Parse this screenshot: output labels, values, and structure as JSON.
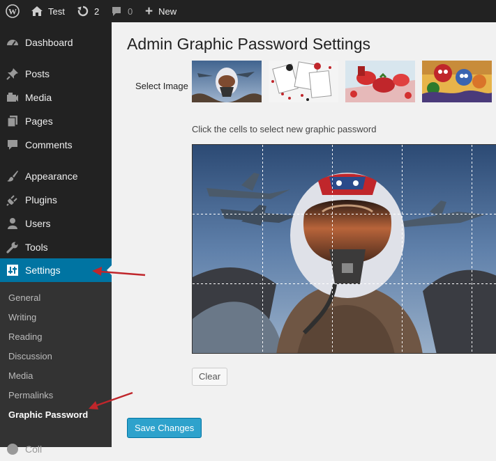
{
  "admin_bar": {
    "site_name": "Test",
    "updates_count": "2",
    "comments_count": "0",
    "new_label": "New"
  },
  "sidebar": {
    "items": [
      {
        "label": "Dashboard",
        "icon": "dashboard-icon"
      },
      {
        "label": "Posts",
        "icon": "pushpin-icon"
      },
      {
        "label": "Media",
        "icon": "camera-icon"
      },
      {
        "label": "Pages",
        "icon": "pages-icon"
      },
      {
        "label": "Comments",
        "icon": "comment-bubble-icon"
      },
      {
        "label": "Appearance",
        "icon": "paintbrush-icon"
      },
      {
        "label": "Plugins",
        "icon": "plug-icon"
      },
      {
        "label": "Users",
        "icon": "user-icon"
      },
      {
        "label": "Tools",
        "icon": "wrench-icon"
      },
      {
        "label": "Settings",
        "icon": "settings-sliders-icon"
      }
    ],
    "submenu": [
      "General",
      "Writing",
      "Reading",
      "Discussion",
      "Media",
      "Permalinks",
      "Graphic Password"
    ],
    "truncated_next_label": "Coll"
  },
  "page": {
    "title": "Admin Graphic Password Settings",
    "select_image_label": "Select Image",
    "thumbnails": [
      "pilot-helmet",
      "playing-cards",
      "strawberries",
      "cartoon-characters"
    ],
    "instructions": "Click the cells to select new graphic password",
    "clear_label": "Clear",
    "save_label": "Save Changes"
  },
  "colors": {
    "accent": "#0074a2",
    "button_primary": "#2ea2cc",
    "sidebar_bg": "#222222",
    "submenu_bg": "#333333",
    "annotation_arrow": "#c0262b"
  }
}
